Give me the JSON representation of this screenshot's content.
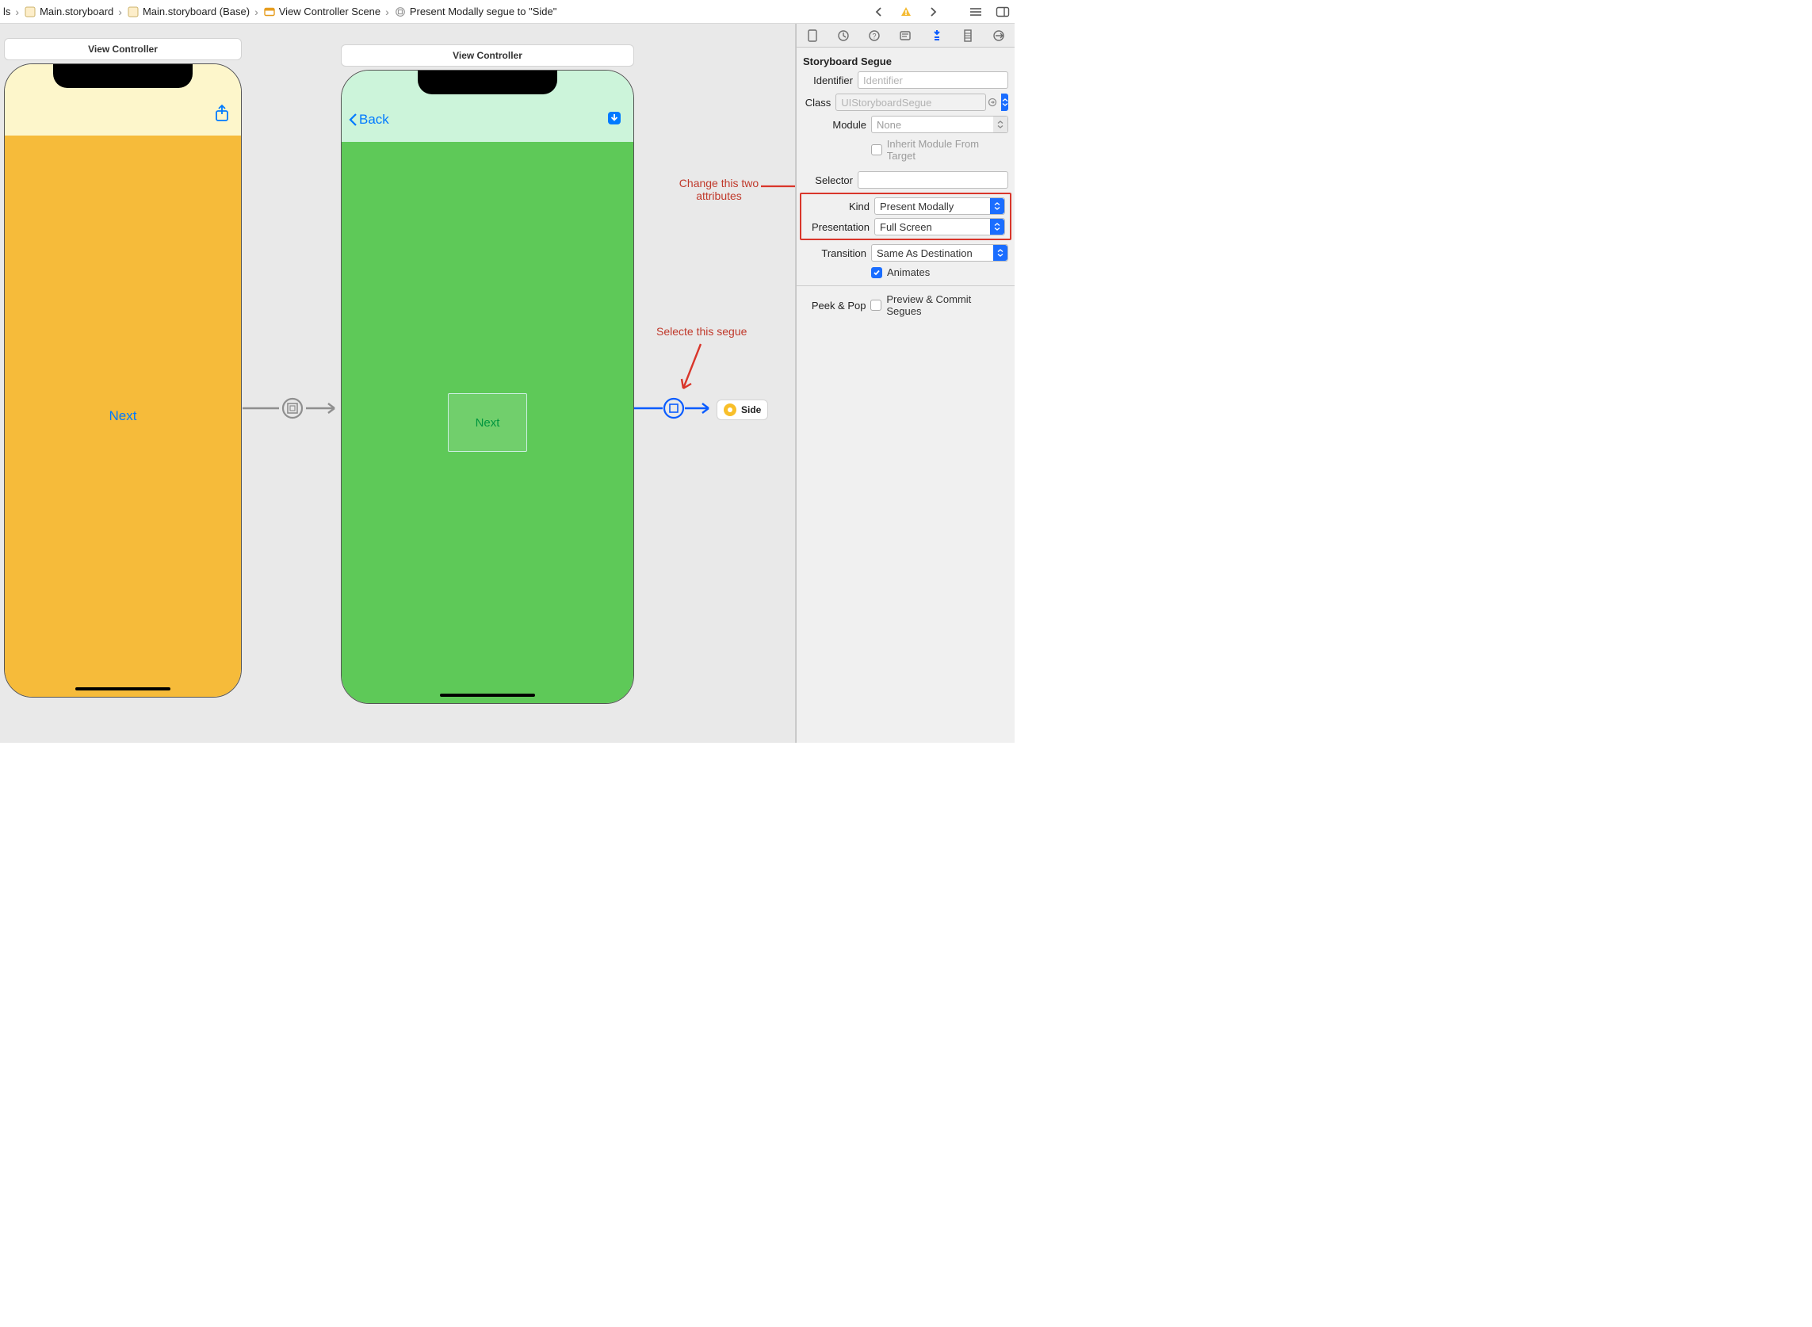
{
  "breadcrumbs": {
    "c0": "ls",
    "c1": "Main.storyboard",
    "c2": "Main.storyboard (Base)",
    "c3": "View Controller Scene",
    "c4": "Present Modally segue to \"Side\""
  },
  "scenes": {
    "s1": {
      "title": "View Controller",
      "next_label": "Next"
    },
    "s2": {
      "title": "View Controller",
      "back_label": "Back",
      "next_label": "Next"
    }
  },
  "side_chip": {
    "label": "Side"
  },
  "annotations": {
    "attr1": "Change this two",
    "attr2": "attributes",
    "segue": "Selecte this segue"
  },
  "inspector": {
    "section_title": "Storyboard Segue",
    "identifier": {
      "label": "Identifier",
      "placeholder": "Identifier",
      "value": ""
    },
    "class": {
      "label": "Class",
      "placeholder": "UIStoryboardSegue",
      "value": ""
    },
    "module": {
      "label": "Module",
      "value": "None"
    },
    "inherit": {
      "label": "Inherit Module From Target",
      "checked": false
    },
    "selector": {
      "label": "Selector",
      "value": ""
    },
    "kind": {
      "label": "Kind",
      "value": "Present Modally"
    },
    "presentation": {
      "label": "Presentation",
      "value": "Full Screen"
    },
    "transition": {
      "label": "Transition",
      "value": "Same As Destination"
    },
    "animates": {
      "label": "Animates",
      "checked": true
    },
    "peek": {
      "label": "Peek & Pop",
      "option": "Preview & Commit Segues",
      "checked": false
    }
  }
}
